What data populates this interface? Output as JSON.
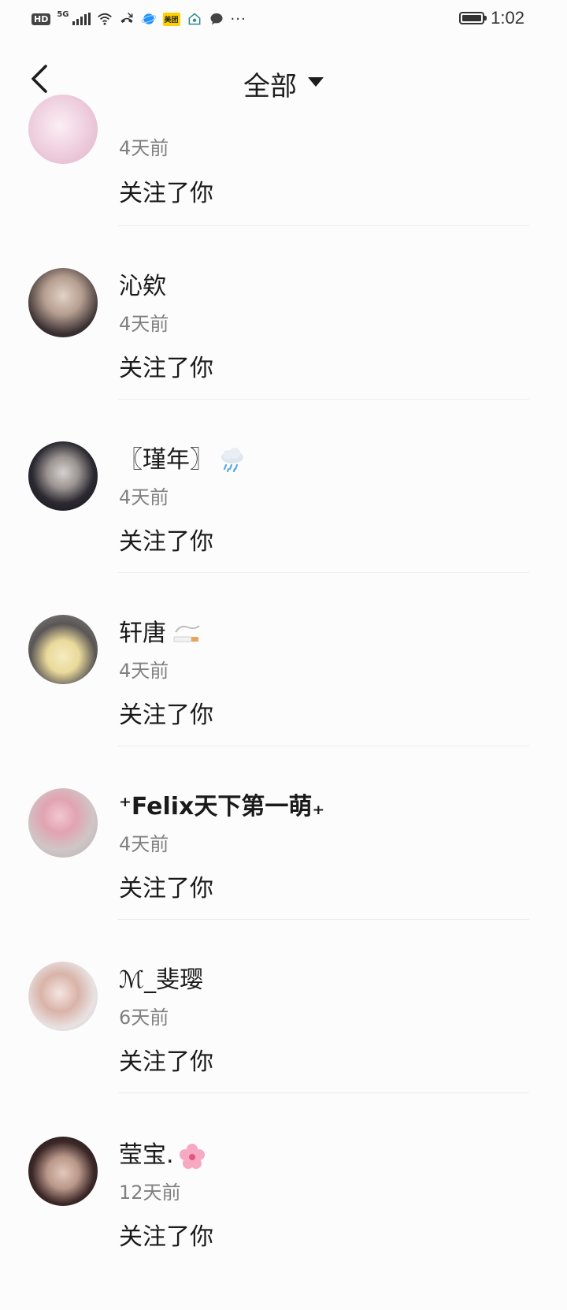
{
  "status_bar": {
    "hd": "HD",
    "network": "5G",
    "meituan": "美团",
    "time": "1:02",
    "battery_level": 0.9,
    "more": "···"
  },
  "header": {
    "back_icon": "chevron-left-icon",
    "title": "全部",
    "dropdown_icon": "caret-down-icon"
  },
  "notifications": [
    {
      "name": "",
      "time": "4天前",
      "action": "关注了你",
      "avatar_colors": [
        "#f3d9e6",
        "#e3bfd1"
      ]
    },
    {
      "name": "沁欸",
      "time": "4天前",
      "action": "关注了你",
      "avatar_colors": [
        "#2b2526",
        "#d8c7bd"
      ]
    },
    {
      "name": "〖瑾年〗",
      "time": "4天前",
      "action": "关注了你",
      "emoji": "rain-cloud-icon",
      "avatar_colors": [
        "#1e1d22",
        "#cfcac8"
      ]
    },
    {
      "name": "轩唐",
      "time": "4天前",
      "action": "关注了你",
      "emoji": "cigarette-icon",
      "avatar_colors": [
        "#6b6b6b",
        "#f0e3b0"
      ]
    },
    {
      "name": "⁺Felix天下第一萌₊",
      "time": "4天前",
      "action": "关注了你",
      "avatar_colors": [
        "#d9cfd0",
        "#e6a9b5"
      ]
    },
    {
      "name": "ℳ_斐璎",
      "time": "6天前",
      "action": "关注了你",
      "avatar_colors": [
        "#e8dcd8",
        "#c79a8f"
      ]
    },
    {
      "name": "莹宝.",
      "time": "12天前",
      "action": "关注了你",
      "emoji": "cherry-blossom-icon",
      "avatar_colors": [
        "#2a1a1a",
        "#d4b6a7"
      ]
    }
  ]
}
